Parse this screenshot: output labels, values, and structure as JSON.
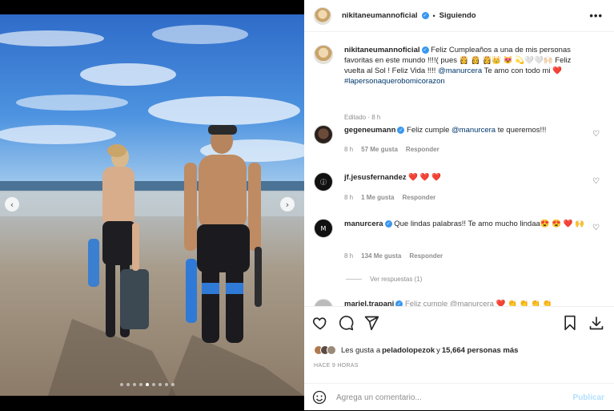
{
  "post": {
    "username": "nikitaneumannoficial",
    "separator": "•",
    "follow_status": "Siguiendo",
    "more_label": "•••",
    "caption_parts": {
      "text1": "Feliz Cumpleaños a una de mis personas favoritas en este mundo !!!!( pues 👸 👸 👸👑 😻 💫🤍🤍🙌🏻 Feliz vuelta al Sol ! Feliz Vida !!!! ",
      "mention": "@manurcera",
      "text2": " Te amo con todo mi ",
      "heart": "❤️",
      "hashtag": "#lapersonaquerobomicorazon"
    },
    "edited_label": "Editado · 8 h"
  },
  "carousel": {
    "prev_label": "‹",
    "next_label": "›",
    "dot_count": 9,
    "active_dot": 4
  },
  "comments": [
    {
      "username": "gegeneumann",
      "verified": true,
      "text_before": "Feliz cumple ",
      "mention": "@manurcera",
      "text_after": " te queremos!!!",
      "time": "8 h",
      "likes": "57 Me gusta",
      "reply": "Responder"
    },
    {
      "username": "jf.jesusfernandez",
      "verified": false,
      "text": "❤️ ❤️ ❤️",
      "time": "8 h",
      "likes": "1 Me gusta",
      "reply": "Responder"
    },
    {
      "username": "manurcera",
      "verified": true,
      "text": "Que lindas palabras!! Te amo mucho lindaa😍 😍 ❤️ 🙌",
      "time": "8 h",
      "likes": "134 Me gusta",
      "reply": "Responder",
      "view_replies": "Ver respuestas (1)"
    },
    {
      "username": "mariel.trapani",
      "verified": true,
      "text": "Feliz cumple @manurcera ❤️ 👏 👏 👏 👏"
    }
  ],
  "actions": {
    "liked_by_prefix": "Les gusta a ",
    "liked_by_user": "peladolopezok",
    "liked_by_suffix": " y ",
    "others_count": "15,664 personas más",
    "time_ago": "HACE 9 HORAS"
  },
  "comment_box": {
    "placeholder": "Agrega un comentario...",
    "publish_label": "Publicar"
  },
  "colors": {
    "link": "#00376b",
    "verified": "#3897f0",
    "meta": "#8e8e8e",
    "heart": "#ed4956",
    "publish_disabled": "#b2dffc"
  },
  "icons": {
    "like": "heart-icon",
    "comment": "comment-icon",
    "share": "paper-plane-icon",
    "save": "bookmark-icon",
    "download": "download-icon",
    "emoji": "smiley-icon",
    "more": "more-dots-icon"
  }
}
